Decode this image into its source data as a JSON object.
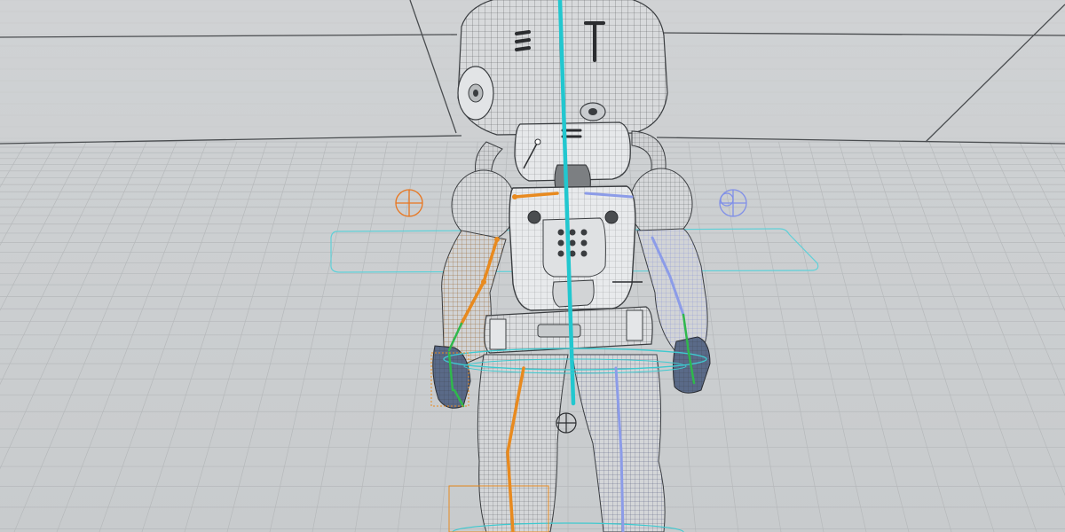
{
  "viewport": {
    "colors": {
      "background": "#c9ccce",
      "grid_line": "#b6b9bb",
      "floor_edge": "#4a4d50",
      "mesh_wire": "#3a3d40",
      "mesh_fill": "#d8dadc",
      "spine_bone": "#22c7cf",
      "left_rig": "#e88a1f",
      "right_rig": "#8c9ce8",
      "hand_controls": "#2fb84c",
      "selection_plane": "#5fd0d8"
    },
    "icons": {
      "left_arm_ik_target": "crosshair-circle-icon",
      "right_arm_ik_target": "crosshair-circle-icon",
      "root_pivot": "crosshair-circle-icon"
    }
  }
}
